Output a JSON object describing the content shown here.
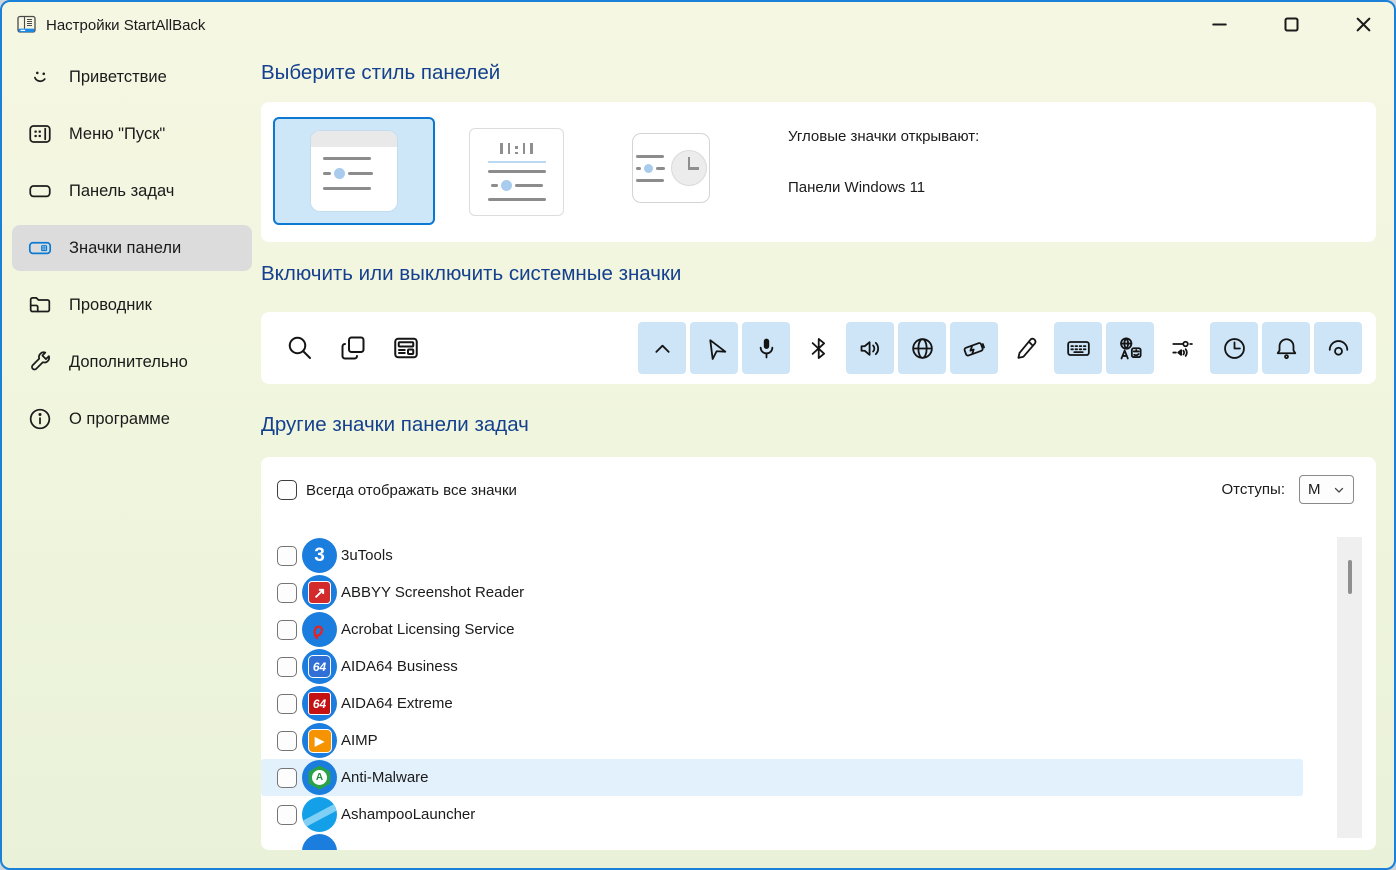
{
  "window": {
    "title": "Настройки StartAllBack",
    "controls": [
      {
        "id": "minimize"
      },
      {
        "id": "maximize"
      },
      {
        "id": "close"
      }
    ]
  },
  "colors": {
    "accent": "#1a80d8",
    "heading": "#14408f",
    "toggle_on_bg": "#cde5f7",
    "row_highlight": "#e3f1fc",
    "sidebar_active_bg": "#dcdcdc"
  },
  "sidebar": {
    "items": [
      {
        "id": "welcome",
        "label": "Приветствие",
        "icon": "smiley-icon",
        "active": false
      },
      {
        "id": "start-menu",
        "label": "Меню \"Пуск\"",
        "icon": "start-menu-icon",
        "active": false
      },
      {
        "id": "taskbar",
        "label": "Панель задач",
        "icon": "taskbar-icon",
        "active": false
      },
      {
        "id": "tray-icons",
        "label": "Значки панели",
        "icon": "tray-icons-icon",
        "active": true
      },
      {
        "id": "explorer",
        "label": "Проводник",
        "icon": "folder-icon",
        "active": false
      },
      {
        "id": "advanced",
        "label": "Дополнительно",
        "icon": "wrench-icon",
        "active": false
      },
      {
        "id": "about",
        "label": "О программе",
        "icon": "info-icon",
        "active": false
      }
    ]
  },
  "style_section": {
    "heading": "Выберите стиль панелей",
    "cards": [
      {
        "id": "win11-panels",
        "selected": true
      },
      {
        "id": "win10-tray",
        "selected": false
      },
      {
        "id": "clock-flyout",
        "selected": false
      }
    ],
    "corner_label": "Угловые значки открывают:",
    "corner_value": "Панели Windows 11"
  },
  "system_icons_section": {
    "heading": "Включить или выключить системные значки",
    "left_icons": [
      {
        "id": "search"
      },
      {
        "id": "task-view"
      },
      {
        "id": "widgets"
      }
    ],
    "toggles": [
      {
        "id": "chevron-up",
        "enabled": true
      },
      {
        "id": "location",
        "enabled": true
      },
      {
        "id": "microphone",
        "enabled": true
      },
      {
        "id": "bluetooth",
        "enabled": false
      },
      {
        "id": "volume",
        "enabled": true
      },
      {
        "id": "network-globe",
        "enabled": true
      },
      {
        "id": "battery",
        "enabled": true
      },
      {
        "id": "pen",
        "enabled": false
      },
      {
        "id": "keyboard",
        "enabled": true
      },
      {
        "id": "language",
        "enabled": true
      },
      {
        "id": "volume-mixer",
        "enabled": false
      },
      {
        "id": "clock",
        "enabled": true
      },
      {
        "id": "bell",
        "enabled": true
      },
      {
        "id": "presence-eye",
        "enabled": true
      }
    ]
  },
  "tray_section": {
    "heading": "Другие значки панели задач",
    "always_show": {
      "label": "Всегда отображать все значки",
      "checked": false
    },
    "spacing": {
      "label": "Отступы:",
      "value": "M"
    },
    "apps": [
      {
        "id": "3utools",
        "name": "3uTools",
        "checked": false,
        "highlighted": false
      },
      {
        "id": "abbyy-screenshot-reader",
        "name": "ABBYY Screenshot Reader",
        "checked": false,
        "highlighted": false
      },
      {
        "id": "acrobat-licensing",
        "name": "Acrobat Licensing Service",
        "checked": false,
        "highlighted": false
      },
      {
        "id": "aida64-business",
        "name": "AIDA64 Business",
        "checked": false,
        "highlighted": false
      },
      {
        "id": "aida64-extreme",
        "name": "AIDA64 Extreme",
        "checked": false,
        "highlighted": false
      },
      {
        "id": "aimp",
        "name": "AIMP",
        "checked": false,
        "highlighted": false
      },
      {
        "id": "anti-malware",
        "name": "Anti-Malware",
        "checked": false,
        "highlighted": true
      },
      {
        "id": "ashampoo-launcher",
        "name": "AshampooLauncher",
        "checked": false,
        "highlighted": false
      },
      {
        "id": "partial-next-app",
        "name": "",
        "checked": false,
        "highlighted": false,
        "partial": true
      }
    ]
  }
}
